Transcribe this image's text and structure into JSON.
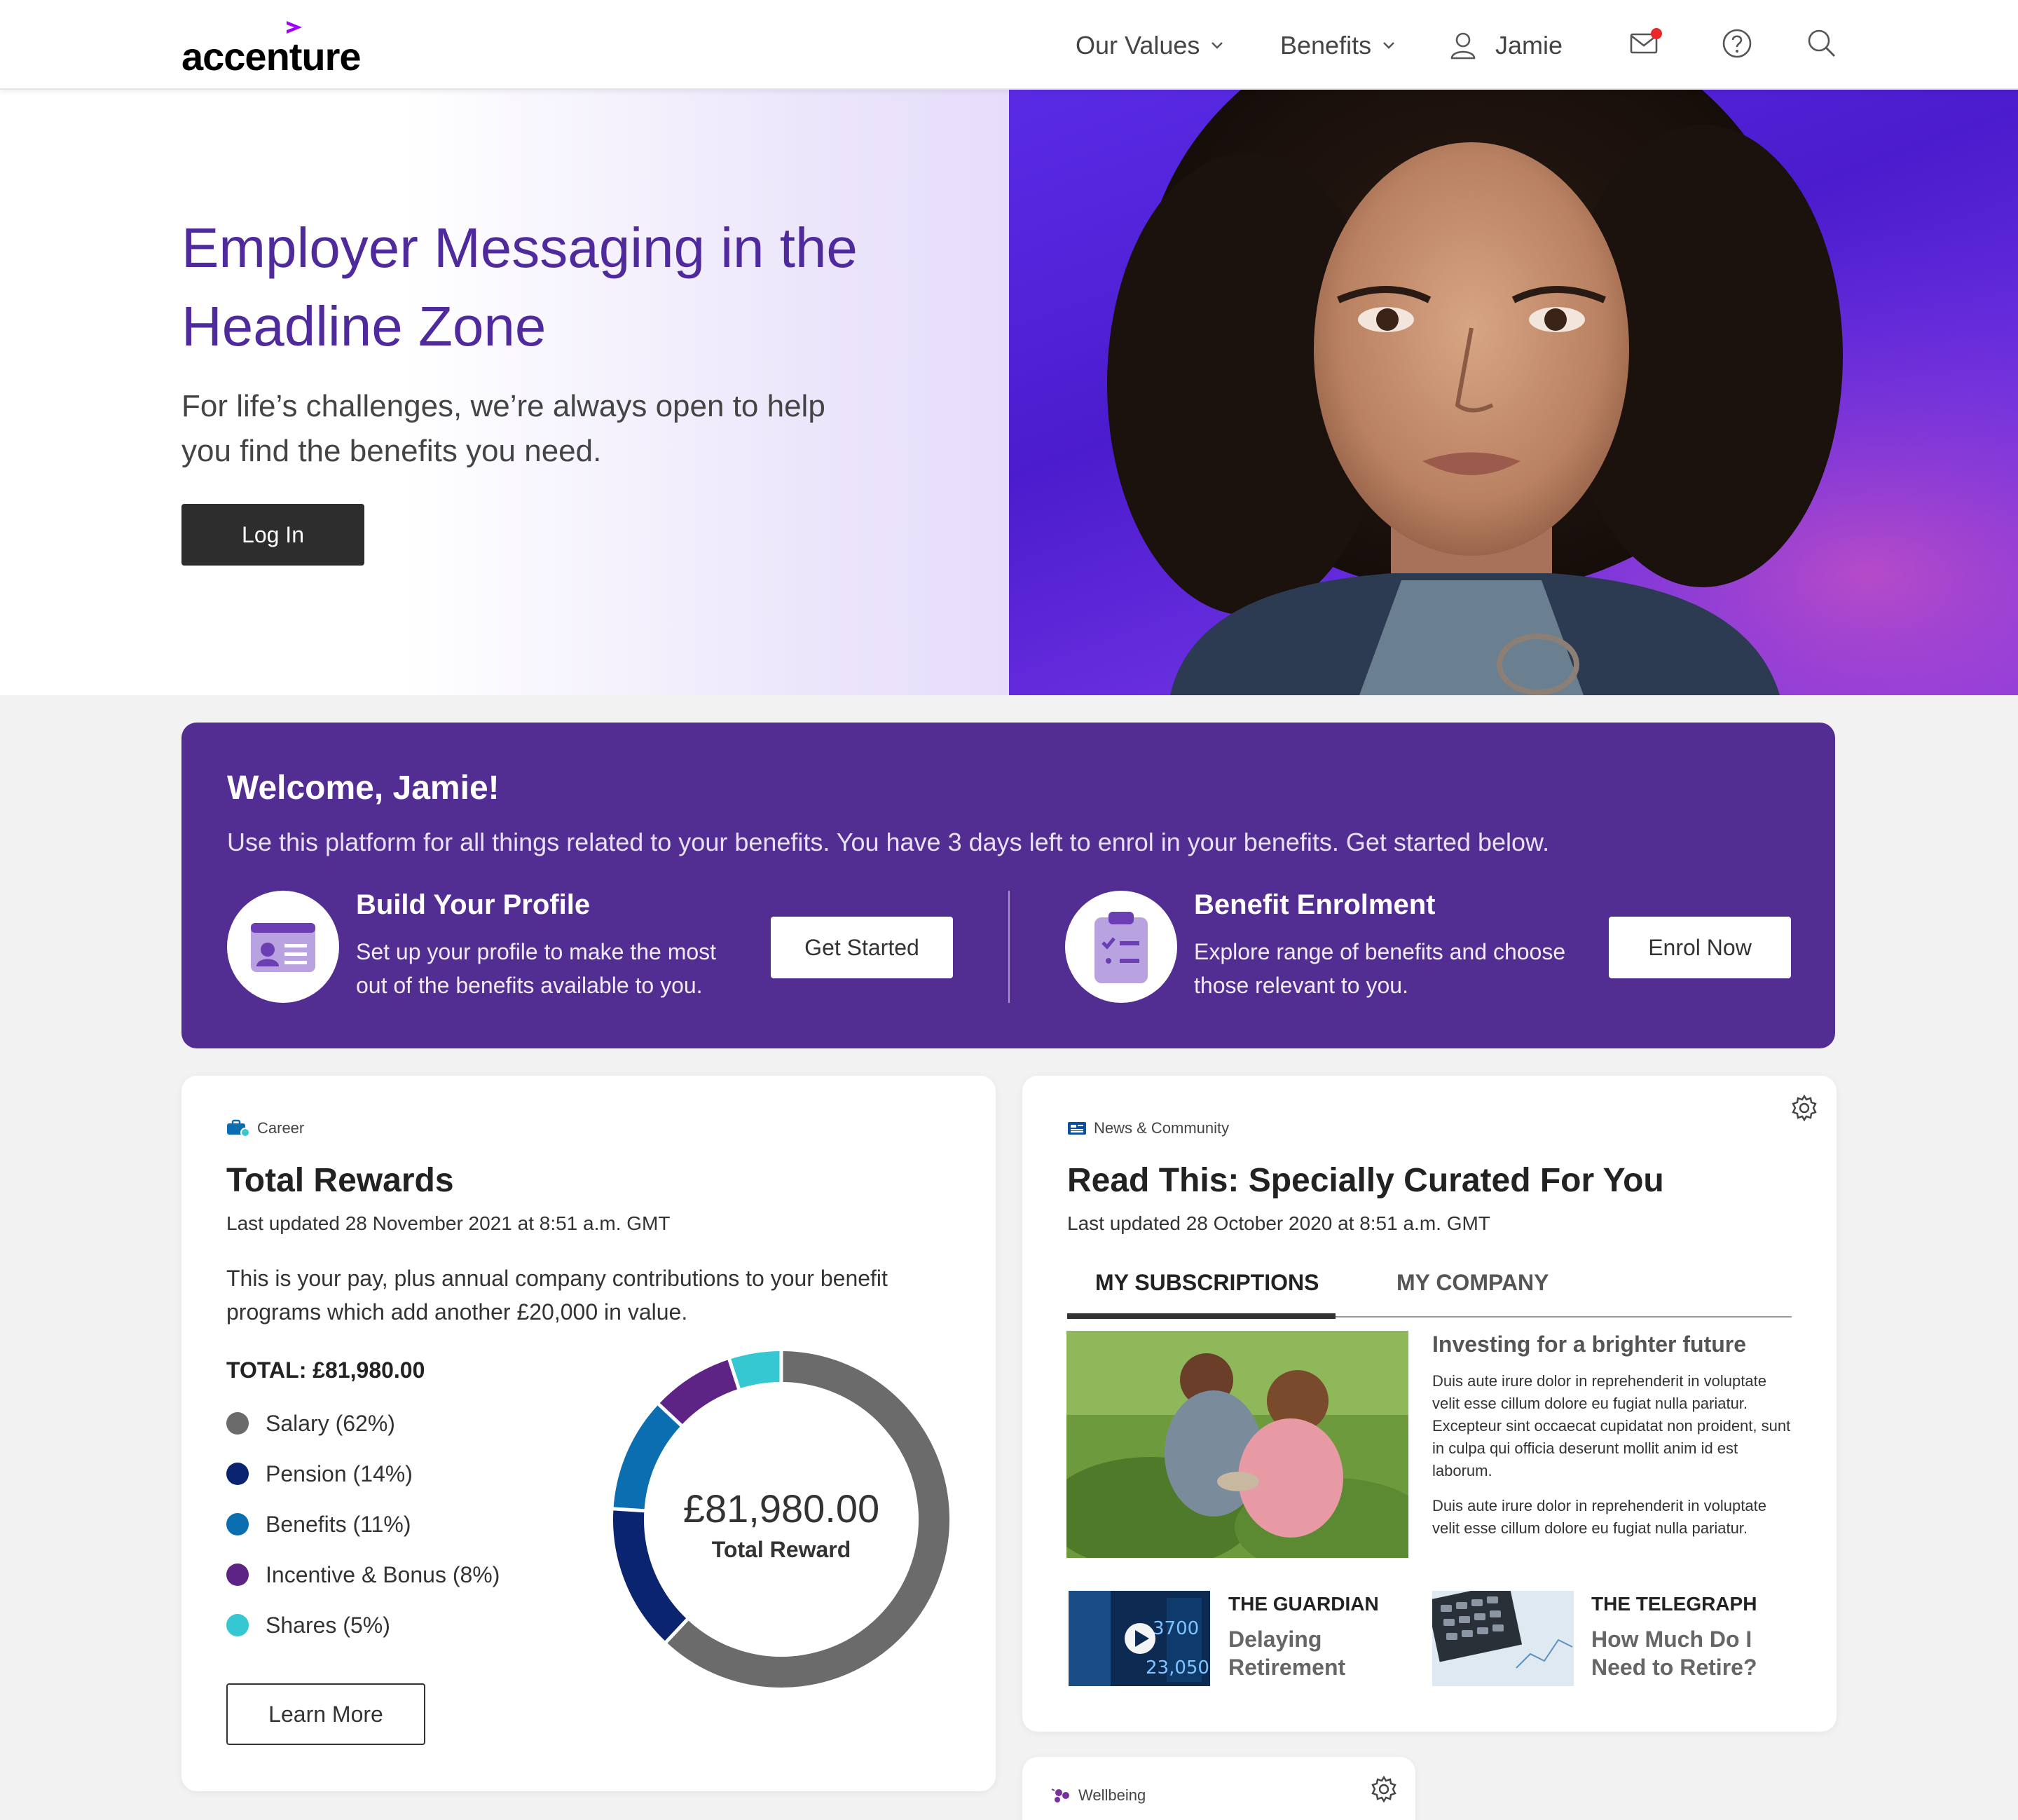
{
  "header": {
    "logo": "accenture",
    "nav": [
      "Our Values",
      "Benefits"
    ],
    "user_name": "Jamie"
  },
  "hero": {
    "title": "Employer Messaging in the Headline Zone",
    "subtitle": "For life’s challenges, we’re always open to help you find the benefits you need.",
    "login_label": "Log In"
  },
  "welcome": {
    "title": "Welcome, Jamie!",
    "lede": "Use this platform for all things related to your benefits. You have 3 days left to enrol in your benefits. Get started below.",
    "profile": {
      "title": "Build Your Profile",
      "desc": "Set up your profile to make the most out of the benefits available to you.",
      "button": "Get Started"
    },
    "enrolment": {
      "title": "Benefit Enrolment",
      "desc": "Explore range of benefits and choose those relevant to you.",
      "button": "Enrol Now"
    }
  },
  "rewards": {
    "category": "Career",
    "title": "Total Rewards",
    "updated": "Last updated 28 November 2021 at 8:51 a.m. GMT",
    "description": "This is your pay, plus annual company contributions to your benefit programs which add another £20,000 in value.",
    "total_label": "TOTAL: £81,980.00",
    "center_amount": "£81,980.00",
    "center_label": "Total Reward",
    "learn_more": "Learn More",
    "colors": {
      "salary": "#6b6b6b",
      "pension": "#0a2470",
      "benefits": "#0a6eb0",
      "incentive": "#5e2485",
      "shares": "#36c8d2"
    }
  },
  "chart_data": {
    "type": "pie",
    "categories": [
      "Salary (62%)",
      "Pension (14%)",
      "Benefits (11%)",
      "Incentive & Bonus (8%)",
      "Shares (5%)"
    ],
    "values": [
      62,
      14,
      11,
      8,
      5
    ]
  },
  "news": {
    "category": "News & Community",
    "title": "Read This: Specially Curated For You",
    "updated": "Last updated 28 October 2020 at 8:51 a.m. GMT",
    "tabs": [
      "MY SUBSCRIPTIONS",
      "MY COMPANY"
    ],
    "featured": {
      "title": "Investing for a brighter future",
      "para1": "Duis aute irure dolor in reprehenderit in voluptate velit esse cillum dolore eu fugiat nulla pariatur. Excepteur sint occaecat cupidatat non proident, sunt in culpa qui officia deserunt mollit anim id est laborum.",
      "para2": "Duis aute irure dolor in reprehenderit in voluptate velit esse cillum dolore eu fugiat nulla pariatur."
    },
    "minis": [
      {
        "source": "THE GUARDIAN",
        "title": "Delaying Retirement"
      },
      {
        "source": "THE TELEGRAPH",
        "title": "How Much Do I Need to Retire?"
      }
    ]
  },
  "wellbeing": {
    "category": "Wellbeing"
  }
}
